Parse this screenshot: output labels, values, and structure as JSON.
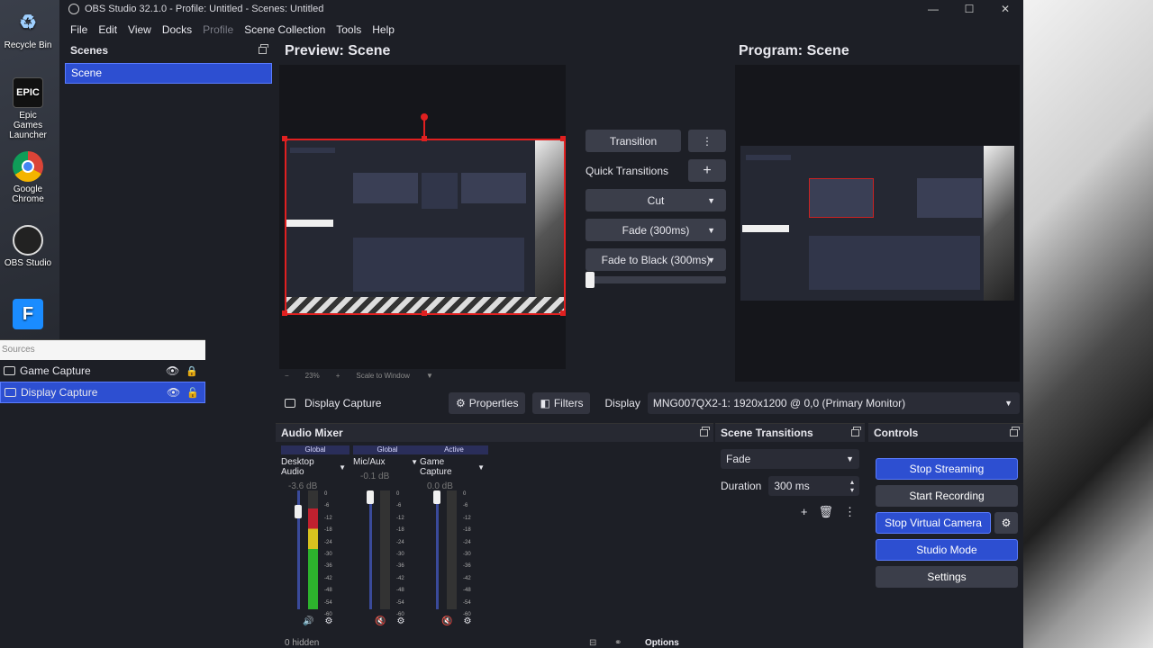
{
  "window": {
    "title": "OBS Studio 32.1.0 - Profile: Untitled - Scenes: Untitled"
  },
  "desktop_icons": [
    {
      "label": "Recycle Bin",
      "icon": "recycle-bin-icon"
    },
    {
      "label": "Epic Games Launcher",
      "icon": "epic-games-icon"
    },
    {
      "label": "Google Chrome",
      "icon": "chrome-icon"
    },
    {
      "label": "OBS Studio",
      "icon": "obs-icon"
    }
  ],
  "menu": [
    "File",
    "Edit",
    "View",
    "Docks",
    "Profile",
    "Scene Collection",
    "Tools",
    "Help"
  ],
  "scenes": {
    "title": "Scenes",
    "items": [
      "Scene"
    ]
  },
  "sources": {
    "title": "Sources",
    "items": [
      "Game Capture",
      "Display Capture"
    ]
  },
  "preview": {
    "title": "Preview: Scene",
    "zoom": "23%",
    "scale": "Scale to Window"
  },
  "program": {
    "title": "Program: Scene"
  },
  "transitions": {
    "transition": "Transition",
    "quick": "Quick Transitions",
    "cut": "Cut",
    "fade": "Fade (300ms)",
    "fade_black": "Fade to Black (300ms)",
    "tbar_position": 0
  },
  "source_toolbar": {
    "name": "Display Capture",
    "properties": "Properties",
    "filters": "Filters",
    "display_label": "Display",
    "display_value": "MNG007QX2-1: 1920x1200 @ 0,0 (Primary Monitor)"
  },
  "mixer": {
    "title": "Audio Mixer",
    "channels": [
      {
        "tag": "Global",
        "name": "Desktop Audio",
        "db": "-3.6 dB",
        "level": 0.85
      },
      {
        "tag": "Global",
        "name": "Mic/Aux",
        "db": "-0.1 dB",
        "level": 0
      },
      {
        "tag": "Active",
        "name": "Game Capture",
        "db": "0.0 dB",
        "level": 0
      }
    ],
    "scale": [
      "0",
      "-6",
      "-12",
      "-18",
      "-24",
      "-30",
      "-36",
      "-42",
      "-48",
      "-54",
      "-60"
    ],
    "hidden": "0 hidden",
    "options": "Options"
  },
  "scene_transitions": {
    "title": "Scene Transitions",
    "selected": "Fade",
    "duration_label": "Duration",
    "duration": "300 ms"
  },
  "controls": {
    "title": "Controls",
    "stop_streaming": "Stop Streaming",
    "start_recording": "Start Recording",
    "stop_virtual": "Stop Virtual Camera",
    "studio_mode": "Studio Mode",
    "settings": "Settings"
  },
  "colors": {
    "accent": "#2d4fd1",
    "selection_border": "#e02020",
    "background": "#1d1f26"
  }
}
